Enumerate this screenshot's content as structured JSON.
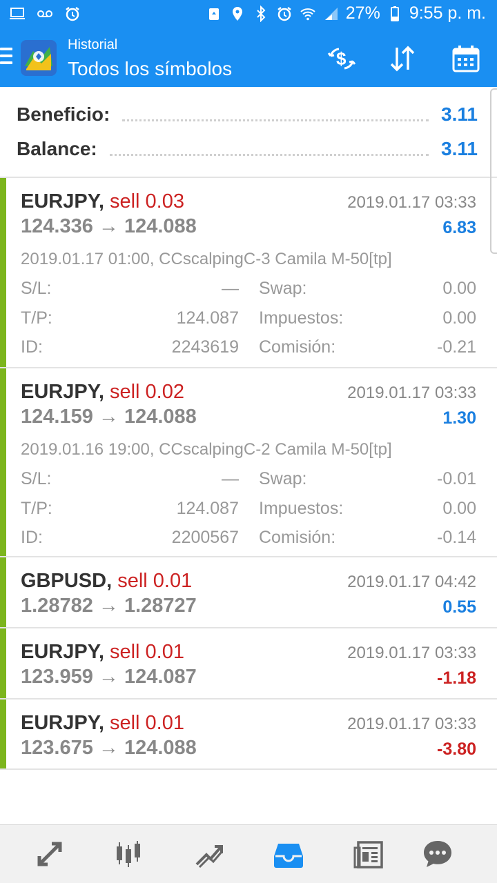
{
  "status_bar": {
    "battery": "27%",
    "time": "9:55 p. m.",
    "icons_left": [
      "laptop-icon",
      "voicemail-icon",
      "alarm-icon"
    ],
    "icons_right": [
      "recycle-icon",
      "location-icon",
      "bluetooth-icon",
      "alarm-icon",
      "wifi-icon",
      "signal-icon",
      "battery-icon"
    ]
  },
  "header": {
    "subtitle": "Historial",
    "title": "Todos los símbolos",
    "actions": [
      "currency-exchange-icon",
      "sort-icon",
      "calendar-icon"
    ]
  },
  "summary": {
    "profit_label": "Beneficio:",
    "profit_value": "3.11",
    "balance_label": "Balance:",
    "balance_value": "3.11"
  },
  "colors": {
    "accent": "#1a8ff2",
    "profit_positive": "#1a7fe0",
    "profit_negative": "#cc2222",
    "sell": "#cc2222",
    "row_marker": "#7cb51d"
  },
  "trades": [
    {
      "symbol": "EURJPY,",
      "type": "sell 0.03",
      "prices": "124.336 → 124.088",
      "date": "2019.01.17 03:33",
      "profit": "6.83",
      "comment": "2019.01.17 01:00, CCscalpingC-3 Camila M-50[tp]",
      "sl_label": "S/L:",
      "sl": "—",
      "swap_label": "Swap:",
      "swap": "0.00",
      "tp_label": "T/P:",
      "tp": "124.087",
      "tax_label": "Impuestos:",
      "tax": "0.00",
      "id_label": "ID:",
      "id": "2243619",
      "commission_label": "Comisión:",
      "commission": "-0.21"
    },
    {
      "symbol": "EURJPY,",
      "type": "sell 0.02",
      "prices": "124.159 → 124.088",
      "date": "2019.01.17 03:33",
      "profit": "1.30",
      "comment": "2019.01.16 19:00, CCscalpingC-2 Camila M-50[tp]",
      "sl_label": "S/L:",
      "sl": "—",
      "swap_label": "Swap:",
      "swap": "-0.01",
      "tp_label": "T/P:",
      "tp": "124.087",
      "tax_label": "Impuestos:",
      "tax": "0.00",
      "id_label": "ID:",
      "id": "2200567",
      "commission_label": "Comisión:",
      "commission": "-0.14"
    },
    {
      "symbol": "GBPUSD,",
      "type": "sell 0.01",
      "prices": "1.28782 → 1.28727",
      "date": "2019.01.17 04:42",
      "profit": "0.55"
    },
    {
      "symbol": "EURJPY,",
      "type": "sell 0.01",
      "prices": "123.959 → 124.087",
      "date": "2019.01.17 03:33",
      "profit": "-1.18"
    },
    {
      "symbol": "EURJPY,",
      "type": "sell 0.01",
      "prices": "123.675 → 124.088",
      "date": "2019.01.17 03:33",
      "profit": "-3.80"
    }
  ],
  "bottom_nav": [
    "quotes-icon",
    "chart-icon",
    "trade-icon",
    "history-icon",
    "news-icon",
    "chat-icon"
  ],
  "bottom_nav_active": "history-icon"
}
